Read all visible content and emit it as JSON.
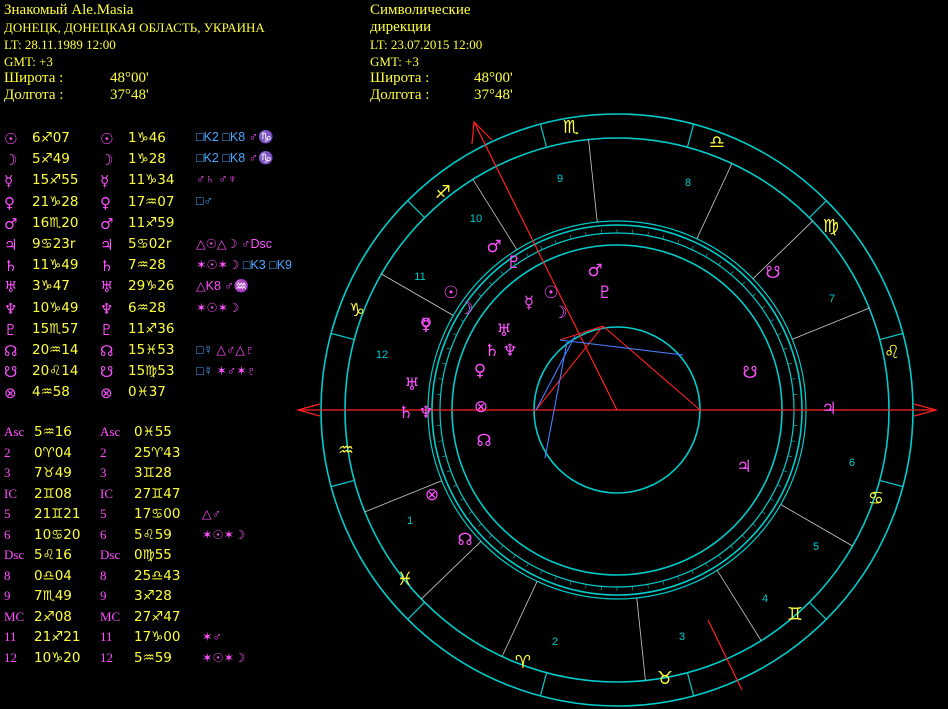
{
  "natal": {
    "name": "Знакомый Ale.Masia",
    "place": "ДОНЕЦК, ДОНЕЦКАЯ ОБЛАСТЬ,  УКРАИНА",
    "lt": "LT: 28.11.1989  12:00",
    "gmt": "GMT: +3",
    "lat_label": "Широта :",
    "lat_value": "48°00'",
    "lon_label": "Долгота :",
    "lon_value": "37°48'"
  },
  "directions": {
    "title1": "Символические",
    "title2": "дирекции",
    "lt": "LT: 23.07.2015  12:00",
    "gmt": "GMT: +3",
    "lat_label": "Широта :",
    "lat_value": "48°00'",
    "lon_label": "Долгота :",
    "lon_value": "37°48'"
  },
  "planets": [
    {
      "g": "☉",
      "n": "6♐07",
      "d": "1♑46",
      "a": [
        [
          "cy",
          "□K2 □K8 "
        ],
        [
          "mg",
          "♂♑"
        ]
      ]
    },
    {
      "g": "☽",
      "n": "5♐49",
      "d": "1♑28",
      "a": [
        [
          "cy",
          "□K2 □K8 "
        ],
        [
          "mg",
          "♂♑"
        ]
      ]
    },
    {
      "g": "☿",
      "n": "15♐55",
      "d": "11♑34",
      "a": [
        [
          "mg",
          "♂♄ ♂♆"
        ]
      ]
    },
    {
      "g": "♀",
      "n": "21♑28",
      "d": "17♒07",
      "a": [
        [
          "cy",
          "□♂"
        ]
      ]
    },
    {
      "g": "♂",
      "n": "16♏20",
      "d": "11♐59",
      "a": []
    },
    {
      "g": "♃",
      "n": "9♋23r",
      "d": "5♋02r",
      "a": [
        [
          "mg",
          "△☉△☽ ♂Dsc"
        ]
      ]
    },
    {
      "g": "♄",
      "n": "11♑49",
      "d": "7♒28",
      "a": [
        [
          "mg",
          "✶☉✶☽ "
        ],
        [
          "cy",
          "□K3 □K9"
        ]
      ]
    },
    {
      "g": "♅",
      "n": "3♑47",
      "d": "29♑26",
      "a": [
        [
          "mg",
          "△K8 ♂♒"
        ]
      ]
    },
    {
      "g": "♆",
      "n": "10♑49",
      "d": "6♒28",
      "a": [
        [
          "mg",
          "✶☉✶☽"
        ]
      ]
    },
    {
      "g": "♇",
      "n": "15♏57",
      "d": "11♐36",
      "a": []
    },
    {
      "g": "☊",
      "n": "20♒14",
      "d": "15♓53",
      "a": [
        [
          "cy",
          "□☿ "
        ],
        [
          "mg",
          "△♂△♇"
        ]
      ]
    },
    {
      "g": "☋",
      "n": "20♌14",
      "d": "15♍53",
      "a": [
        [
          "cy",
          "□☿ "
        ],
        [
          "mg",
          "✶♂✶♇"
        ]
      ]
    },
    {
      "g": "⊗",
      "n": "4♒58",
      "d": "0♓37",
      "a": []
    }
  ],
  "houses": [
    {
      "l": "Asc",
      "n": "5♒16",
      "dl": "Asc",
      "d": "0♓55",
      "a": []
    },
    {
      "l": "2",
      "n": "0♈04",
      "dl": "2",
      "d": "25♈43",
      "a": []
    },
    {
      "l": "3",
      "n": "7♉49",
      "dl": "3",
      "d": "3♊28",
      "a": []
    },
    {
      "l": "IC",
      "n": "2♊08",
      "dl": "IC",
      "d": "27♊47",
      "a": []
    },
    {
      "l": "5",
      "n": "21♊21",
      "dl": "5",
      "d": "17♋00",
      "a": [
        [
          "mg",
          "△♂"
        ]
      ]
    },
    {
      "l": "6",
      "n": "10♋20",
      "dl": "6",
      "d": "5♌59",
      "a": [
        [
          "mg",
          "✶☉✶☽"
        ]
      ]
    },
    {
      "l": "Dsc",
      "n": "5♌16",
      "dl": "Dsc",
      "d": "0♍55",
      "a": []
    },
    {
      "l": "8",
      "n": "0♎04",
      "dl": "8",
      "d": "25♎43",
      "a": []
    },
    {
      "l": "9",
      "n": "7♏49",
      "dl": "9",
      "d": "3♐28",
      "a": []
    },
    {
      "l": "MC",
      "n": "2♐08",
      "dl": "MC",
      "d": "27♐47",
      "a": []
    },
    {
      "l": "11",
      "n": "21♐21",
      "dl": "11",
      "d": "17♑00",
      "a": [
        [
          "mg",
          "✶♂"
        ]
      ]
    },
    {
      "l": "12",
      "n": "10♑20",
      "dl": "12",
      "d": "5♒59",
      "a": [
        [
          "mg",
          "✶☉✶☽"
        ]
      ]
    }
  ],
  "wheel": {
    "signs": [
      "♒",
      "♓",
      "♈",
      "♉",
      "♊",
      "♋",
      "♌",
      "♍",
      "♎",
      "♏",
      "♐",
      "♑"
    ],
    "house_numbers": [
      "1",
      "2",
      "3",
      "4",
      "5",
      "6",
      "7",
      "8",
      "9",
      "10",
      "11",
      "12"
    ],
    "outer_planets": [
      "♂",
      "♇",
      "☉",
      "☽",
      "♄",
      "♆",
      "♅",
      "♀",
      "☿",
      "♃",
      "☊",
      "☋",
      "⊗"
    ],
    "inner_planets": [
      "♂",
      "♇",
      "☉",
      "☽",
      "☿",
      "♅",
      "♄",
      "♆",
      "♀",
      "⊗",
      "☊",
      "♃",
      "☋"
    ],
    "colors": {
      "ring": "#00cccc",
      "axis": "#ff2020",
      "signs": "#ffff40",
      "planets": "#ff50ff",
      "aspect_red": "#ff2020",
      "aspect_blue": "#4a7cff"
    }
  }
}
